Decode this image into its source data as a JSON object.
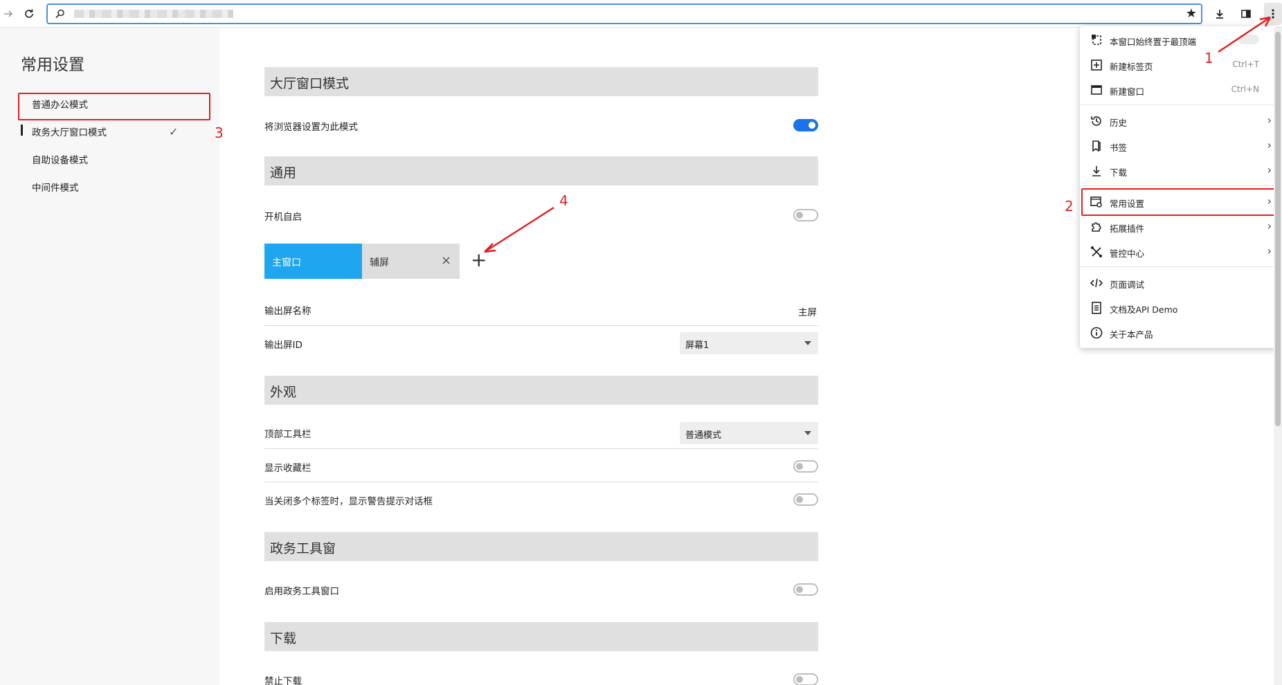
{
  "toolbar": {
    "back_icon": "arrow-right-icon",
    "reload_icon": "reload-icon",
    "address": {
      "placeholder": "",
      "value": ""
    },
    "bookmark_icon": "star-icon",
    "download_icon": "download-icon",
    "sidepanel_icon": "sidepanel-icon",
    "menu_icon": "three-dots-vertical-icon"
  },
  "sidebar": {
    "title": "常用设置",
    "items": [
      {
        "label": "普通办公模式"
      },
      {
        "label": "政务大厅窗口模式",
        "selected": true
      },
      {
        "label": "自助设备模式"
      },
      {
        "label": "中间件模式"
      }
    ]
  },
  "main": {
    "sections": {
      "hall": {
        "title": "大厅窗口模式",
        "set_default_label": "将浏览器设置为此模式",
        "set_default_on": true
      },
      "general": {
        "title": "通用",
        "autostart_label": "开机自启",
        "autostart_on": false,
        "tabs": [
          {
            "label": "主窗口"
          },
          {
            "label": "辅屏"
          }
        ],
        "tab_close": "×",
        "tab_add": "+",
        "screen_name_label": "输出屏名称",
        "screen_name_value": "主屏",
        "screen_id_label": "输出屏ID",
        "screen_id_value": "屏幕1"
      },
      "appearance": {
        "title": "外观",
        "toolbar_label": "顶部工具栏",
        "toolbar_value": "普通模式",
        "bookmarks_label": "显示收藏栏",
        "bookmarks_on": false,
        "close_warn_label": "当关闭多个标签时，显示警告提示对话框",
        "close_warn_on": false
      },
      "gov_tools": {
        "title": "政务工具窗",
        "enable_label": "启用政务工具窗口",
        "enable_on": false
      },
      "download": {
        "title": "下载",
        "disable_label": "禁止下载",
        "disable_on": false
      }
    }
  },
  "menu": {
    "items": [
      {
        "label": "本窗口始终置于最顶端",
        "icon": "pin-window-icon"
      },
      {
        "label": "新建标签页",
        "shortcut": "Ctrl+T",
        "icon": "new-tab-icon"
      },
      {
        "label": "新建窗口",
        "shortcut": "Ctrl+N",
        "icon": "new-window-icon"
      },
      {
        "label": "历史",
        "icon": "history-icon"
      },
      {
        "label": "书签",
        "icon": "bookmarks-icon"
      },
      {
        "label": "下载",
        "icon": "download-icon"
      },
      {
        "label": "常用设置",
        "icon": "settings-icon"
      },
      {
        "label": "拓展插件",
        "icon": "extension-icon"
      },
      {
        "label": "管控中心",
        "icon": "tools-icon"
      },
      {
        "label": "页面调试",
        "icon": "code-icon"
      },
      {
        "label": "文档及API Demo",
        "icon": "document-icon"
      },
      {
        "label": "关于本产品",
        "icon": "info-icon"
      }
    ]
  },
  "annotations": {
    "a1": "1",
    "a2": "2",
    "a3": "3",
    "a4": "4"
  },
  "colors": {
    "accent": "#1a73e8",
    "tab_active": "#1fa6f0",
    "annotation": "#e02020"
  }
}
